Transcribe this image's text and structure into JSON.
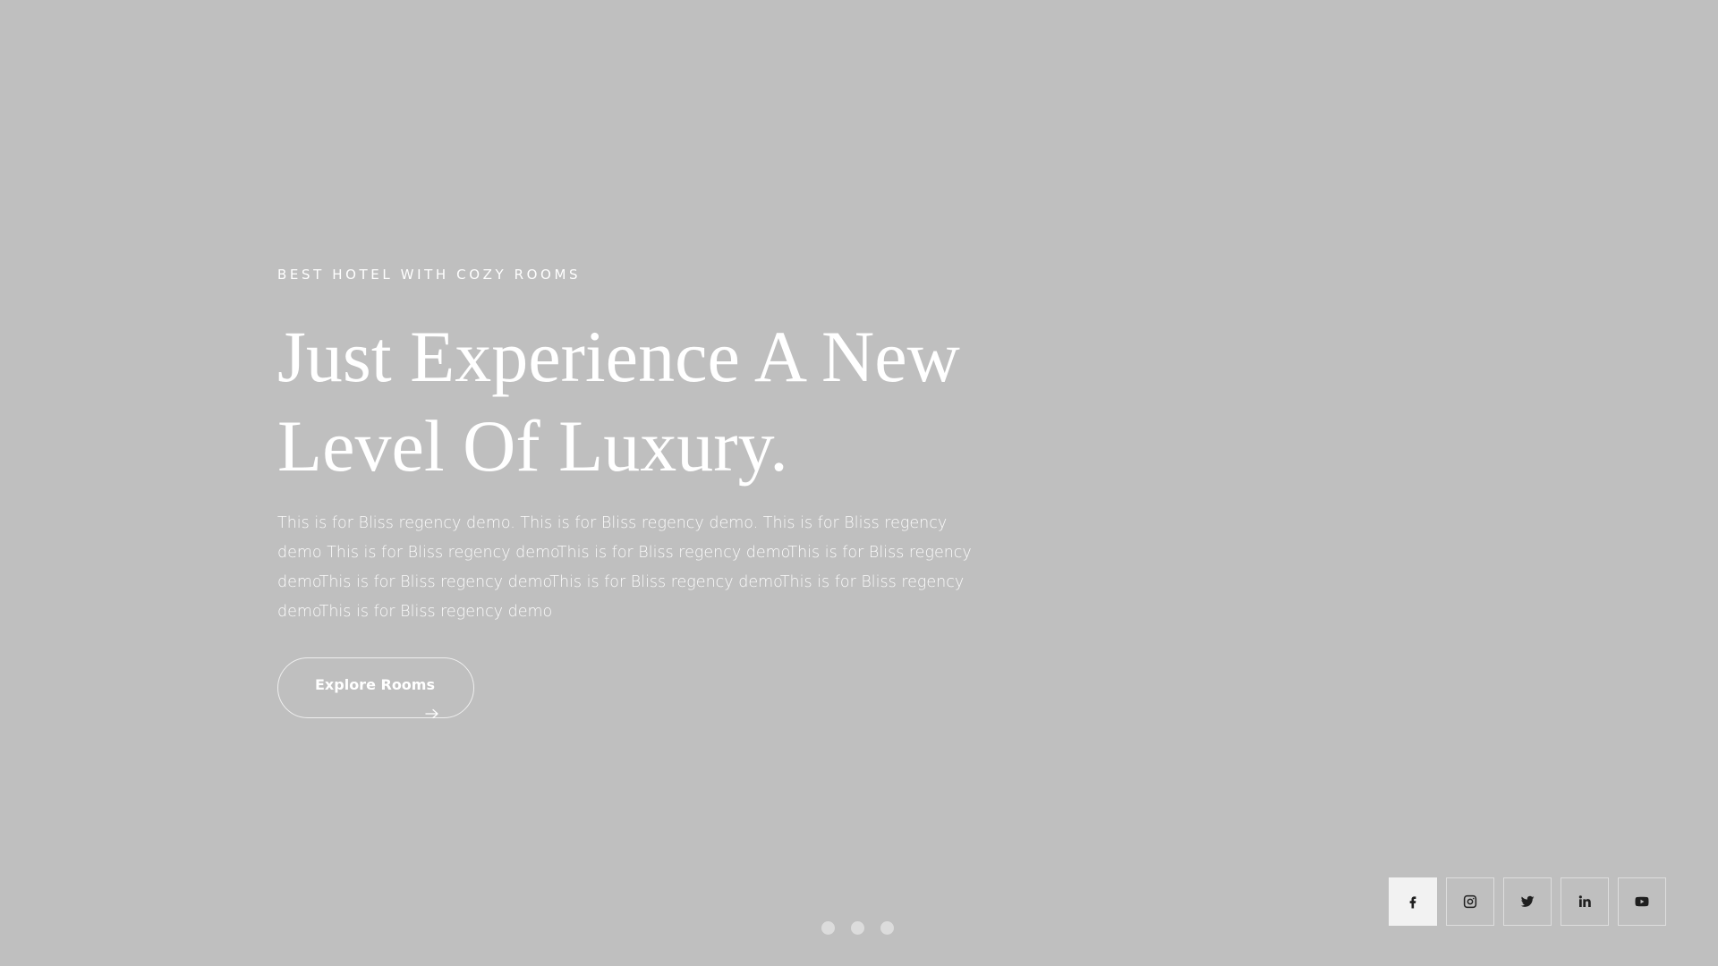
{
  "hero": {
    "eyebrow": "BEST HOTEL WITH COZY ROOMS",
    "headline_line1": "Just Experience A New",
    "headline_line2": "Level Of Luxury.",
    "description": "This is for Bliss regency demo. This is for Bliss regency demo. This is for Bliss regency demo This is for Bliss regency demoThis is for Bliss regency demoThis is for Bliss regency demoThis is for Bliss regency demoThis is for Bliss regency demoThis is for Bliss regency demoThis is for Bliss regency demo",
    "cta_label": "Explore Rooms",
    "cta_icon": "arrow-right-icon"
  },
  "slider": {
    "dots": 3,
    "active_index": 0
  },
  "social": {
    "items": [
      {
        "name": "facebook",
        "icon": "facebook-icon",
        "active": true
      },
      {
        "name": "instagram",
        "icon": "instagram-icon",
        "active": false
      },
      {
        "name": "twitter",
        "icon": "twitter-icon",
        "active": false
      },
      {
        "name": "linkedin",
        "icon": "linkedin-icon",
        "active": false
      },
      {
        "name": "youtube",
        "icon": "youtube-icon",
        "active": false
      }
    ]
  },
  "colors": {
    "background": "#bfbfbf",
    "text": "#ffffff",
    "social_active_bg": "#f2f2f2",
    "dot": "#dcdcdc",
    "icon": "#1f1f1f"
  }
}
